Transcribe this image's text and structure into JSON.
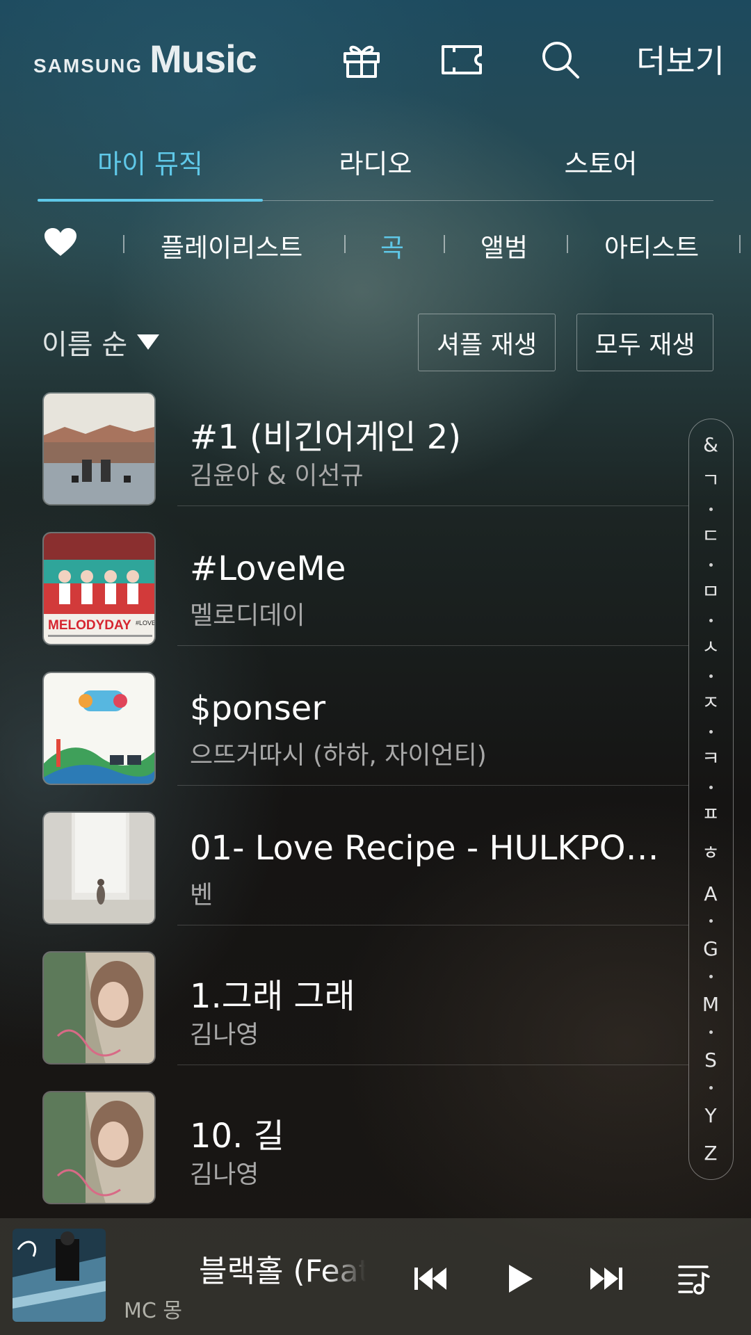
{
  "header": {
    "logo_samsung": "SAMSUNG",
    "logo_music": "Music",
    "icons": [
      "gift-icon",
      "ticket-icon",
      "search-icon"
    ],
    "more_label": "더보기"
  },
  "tabs": [
    {
      "label": "마이 뮤직",
      "active": true
    },
    {
      "label": "라디오",
      "active": false
    },
    {
      "label": "스토어",
      "active": false
    }
  ],
  "subtabs": {
    "favorites_icon": "heart-icon",
    "items": [
      {
        "label": "플레이리스트",
        "active": false
      },
      {
        "label": "곡",
        "active": true
      },
      {
        "label": "앨범",
        "active": false
      },
      {
        "label": "아티스트",
        "active": false
      }
    ]
  },
  "toolbar": {
    "sort_label": "이름 순",
    "shuffle_label": "셔플 재생",
    "play_all_label": "모두 재생"
  },
  "songs": [
    {
      "title": "#1 (비긴어게인 2)",
      "artist": "김윤아 & 이선규"
    },
    {
      "title": "#LoveMe",
      "artist": "멜로디데이",
      "art_text": "MELODYDAY",
      "art_text2": "#LOVE ME"
    },
    {
      "title": "$ponser",
      "artist": "으뜨거따시 (하하, 자이언티)"
    },
    {
      "title": "01- Love Recipe - HULKPOP...",
      "artist": "벤"
    },
    {
      "title": "1.그래 그래",
      "artist": "김나영"
    },
    {
      "title": "10.  길",
      "artist": "김나영"
    }
  ],
  "index": {
    "letters": [
      "&",
      "ㄱ",
      "ㄷ",
      "ㅁ",
      "ㅅ",
      "ㅈ",
      "ㅋ",
      "ㅍ",
      "ㅎ",
      "A",
      "G",
      "M",
      "S",
      "Y",
      "Z"
    ]
  },
  "player": {
    "title": "블랙홀 (Feat.",
    "artist": "MC 몽",
    "icons": [
      "previous-icon",
      "play-icon",
      "next-icon",
      "queue-icon"
    ]
  },
  "colors": {
    "accent": "#5fc8e8",
    "text": "#ffffff",
    "subtext": "#a8a8a8"
  }
}
